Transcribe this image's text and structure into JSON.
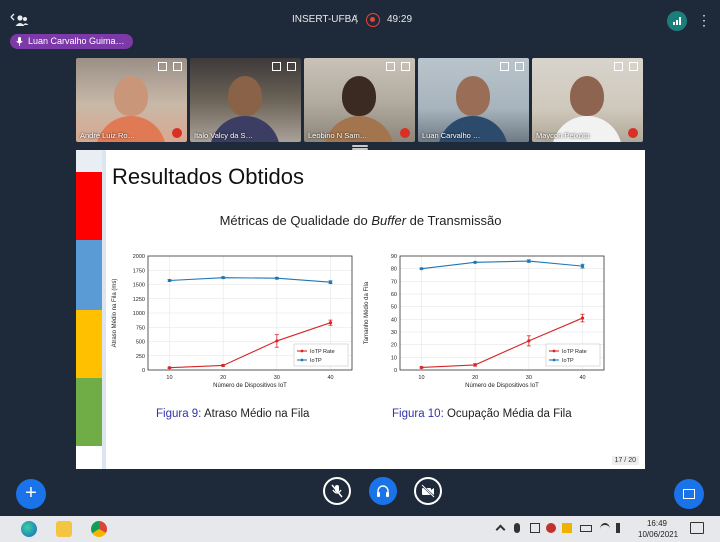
{
  "meeting": {
    "name": "INSERT-UFBA",
    "separator": "|",
    "elapsed": "49:29",
    "presenter_label": "Luan Carvalho Guima…"
  },
  "participants": [
    {
      "name": "André Luiz Ro…",
      "muted": true
    },
    {
      "name": "Italo Valcy da S…",
      "muted": false
    },
    {
      "name": "Leobino N Sam…",
      "muted": true
    },
    {
      "name": "Luan Carvalho …",
      "muted": false,
      "active": true
    },
    {
      "name": "Maycon Peixoto",
      "muted": true
    }
  ],
  "slide": {
    "title": "Resultados Obtidos",
    "subtitle_pre": "Métricas de Qualidade do",
    "subtitle_italic": "Buffer",
    "subtitle_post": "de Transmissão",
    "page": "17 / 20",
    "captions": [
      {
        "fig": "Figura 9:",
        "text": "Atraso Médio na Fila"
      },
      {
        "fig": "Figura 10:",
        "text": "Ocupação Média da Fila"
      }
    ],
    "sidebar_colors": [
      "#e8eef4",
      "#ff0000",
      "#5b9bd5",
      "#ffc000",
      "#70ad47",
      "#ffffff"
    ]
  },
  "chart_data": [
    {
      "type": "line",
      "xlabel": "Número de Dispositivos IoT",
      "ylabel": "Atraso Médio na Fila (ms)",
      "x": [
        10,
        20,
        30,
        40
      ],
      "ylim": [
        0,
        2000
      ],
      "yticks": [
        0,
        250,
        500,
        750,
        1000,
        1250,
        1500,
        1750,
        2000
      ],
      "xticks": [
        10,
        20,
        30,
        40
      ],
      "legend": "bottom-right",
      "grid": true,
      "series": [
        {
          "name": "IoTP Rate",
          "color": "#d62728",
          "values": [
            40,
            80,
            510,
            830
          ],
          "err": [
            10,
            15,
            110,
            45
          ]
        },
        {
          "name": "IoTP",
          "color": "#1f77b4",
          "values": [
            1570,
            1620,
            1610,
            1540
          ],
          "err": [
            15,
            15,
            15,
            25
          ]
        }
      ]
    },
    {
      "type": "line",
      "xlabel": "Número de Dispositivos IoT",
      "ylabel": "Tamanho Médio da Fila",
      "x": [
        10,
        20,
        30,
        40
      ],
      "ylim": [
        0,
        90
      ],
      "yticks": [
        0,
        10,
        20,
        30,
        40,
        50,
        60,
        70,
        80,
        90
      ],
      "xticks": [
        10,
        20,
        30,
        40
      ],
      "legend": "bottom-right",
      "grid": true,
      "series": [
        {
          "name": "IoTP Rate",
          "color": "#d62728",
          "values": [
            2,
            4,
            23,
            41
          ],
          "err": [
            0.5,
            1,
            4,
            3
          ]
        },
        {
          "name": "IoTP",
          "color": "#1f77b4",
          "values": [
            80,
            85,
            86,
            82
          ],
          "err": [
            0.5,
            0.5,
            1,
            1.5
          ]
        }
      ]
    }
  ],
  "controls": {
    "add_label": "+"
  },
  "taskbar": {
    "time": "16:49",
    "date": "10/06/2021"
  }
}
